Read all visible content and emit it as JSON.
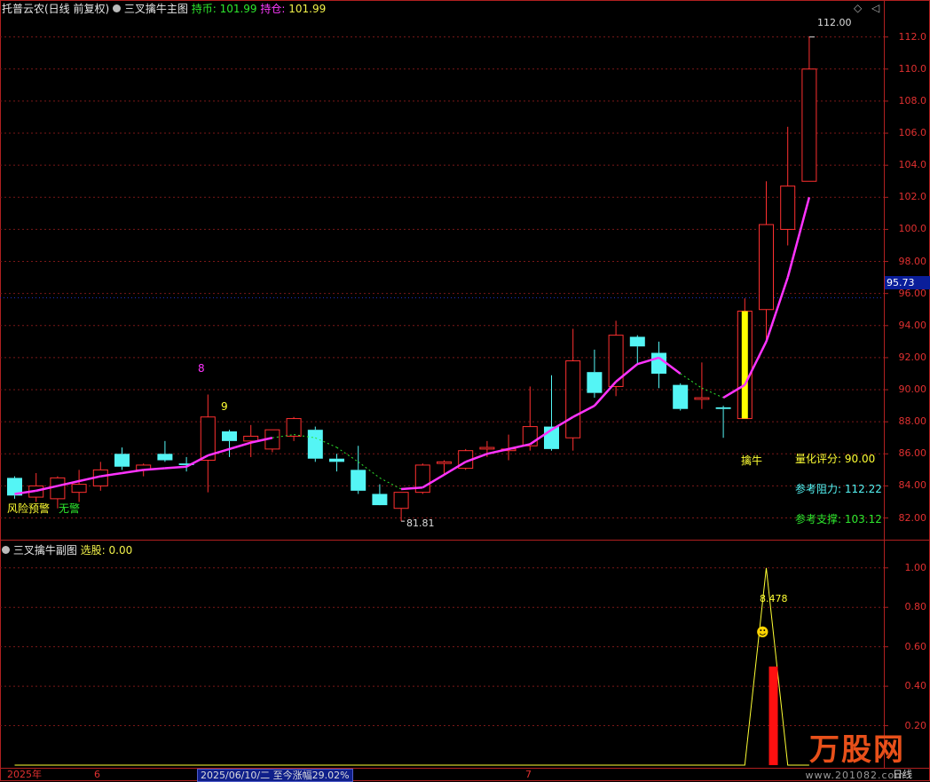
{
  "header": {
    "title": "托普云农(日线 前复权)",
    "indicator": "三叉擒牛主图",
    "close_label": "持币:",
    "close_value": "101.99",
    "hold_label": "持仓:",
    "hold_value": "101.99"
  },
  "subheader": {
    "indicator": "三叉擒牛副图",
    "select_label": "选股:",
    "select_value": "0.00"
  },
  "main_axis": [
    "112.0",
    "110.0",
    "108.0",
    "106.0",
    "104.0",
    "102.0",
    "100.0",
    "98.00",
    "96.00",
    "94.00",
    "92.00",
    "90.00",
    "88.00",
    "86.00",
    "84.00",
    "82.00"
  ],
  "current_price": "95.73",
  "sub_axis": [
    "1.00",
    "0.80",
    "0.60",
    "0.40",
    "0.20"
  ],
  "annotations": {
    "high_label": "112.00",
    "low_label": "81.81",
    "count8": "8",
    "count9": "9",
    "signal": "擒牛",
    "warn_left": "风险预警",
    "warn_right": "无警",
    "sub_value": "8.478"
  },
  "info": {
    "score_label": "量化评分:",
    "score_value": "90.00",
    "resist_label": "参考阻力:",
    "resist_value": "112.22",
    "support_label": "参考支撑:",
    "support_value": "103.12"
  },
  "bottom": {
    "year": "2025年",
    "month6": "6",
    "range_text": "2025/06/10/二  至今涨幅29.02%",
    "month7": "7",
    "period": "日线"
  },
  "watermark": {
    "brand": "万股网",
    "url": "www.201082.com"
  },
  "colors": {
    "up": "#ff3030",
    "down": "#54f5f5",
    "ma": "#ff33ff",
    "signal_bar": "#ffff00",
    "sub_line": "#ffff33",
    "grid": "#7a1818"
  },
  "chart_data": {
    "type": "candlestick",
    "ohlc": [
      {
        "o": 84.5,
        "h": 84.6,
        "l": 83.2,
        "c": 83.4
      },
      {
        "o": 83.3,
        "h": 84.8,
        "l": 83.0,
        "c": 84.0
      },
      {
        "o": 83.2,
        "h": 84.6,
        "l": 82.6,
        "c": 84.5
      },
      {
        "o": 83.6,
        "h": 85.0,
        "l": 83.0,
        "c": 84.1
      },
      {
        "o": 84.0,
        "h": 85.5,
        "l": 83.7,
        "c": 85.0
      },
      {
        "o": 86.0,
        "h": 86.4,
        "l": 85.0,
        "c": 85.2
      },
      {
        "o": 85.0,
        "h": 85.4,
        "l": 84.6,
        "c": 85.3
      },
      {
        "o": 86.0,
        "h": 86.8,
        "l": 85.5,
        "c": 85.6
      },
      {
        "o": 85.4,
        "h": 85.8,
        "l": 84.9,
        "c": 85.3
      },
      {
        "o": 85.6,
        "h": 89.7,
        "l": 83.6,
        "c": 88.3
      },
      {
        "o": 87.4,
        "h": 87.5,
        "l": 85.8,
        "c": 86.8
      },
      {
        "o": 86.8,
        "h": 87.8,
        "l": 85.8,
        "c": 87.1
      },
      {
        "o": 86.3,
        "h": 87.4,
        "l": 86.1,
        "c": 87.5
      },
      {
        "o": 87.1,
        "h": 88.3,
        "l": 86.8,
        "c": 88.2
      },
      {
        "o": 87.5,
        "h": 87.7,
        "l": 85.5,
        "c": 85.7
      },
      {
        "o": 85.7,
        "h": 86.0,
        "l": 84.9,
        "c": 85.5
      },
      {
        "o": 85.0,
        "h": 86.5,
        "l": 83.5,
        "c": 83.7
      },
      {
        "o": 83.5,
        "h": 84.1,
        "l": 82.9,
        "c": 82.8
      },
      {
        "o": 82.6,
        "h": 83.6,
        "l": 81.8,
        "c": 83.6
      },
      {
        "o": 83.6,
        "h": 85.4,
        "l": 83.5,
        "c": 85.3
      },
      {
        "o": 85.4,
        "h": 85.6,
        "l": 84.7,
        "c": 85.5
      },
      {
        "o": 85.1,
        "h": 86.3,
        "l": 85.0,
        "c": 86.2
      },
      {
        "o": 86.3,
        "h": 86.8,
        "l": 85.8,
        "c": 86.4
      },
      {
        "o": 86.2,
        "h": 87.2,
        "l": 85.6,
        "c": 86.3
      },
      {
        "o": 86.5,
        "h": 90.2,
        "l": 86.2,
        "c": 87.7
      },
      {
        "o": 87.7,
        "h": 90.9,
        "l": 86.2,
        "c": 86.3
      },
      {
        "o": 87.0,
        "h": 93.8,
        "l": 86.2,
        "c": 91.8
      },
      {
        "o": 91.1,
        "h": 92.5,
        "l": 89.5,
        "c": 89.8
      },
      {
        "o": 90.2,
        "h": 94.3,
        "l": 89.6,
        "c": 93.4
      },
      {
        "o": 93.3,
        "h": 93.4,
        "l": 91.6,
        "c": 92.7
      },
      {
        "o": 92.3,
        "h": 93.0,
        "l": 90.1,
        "c": 91.0
      },
      {
        "o": 90.3,
        "h": 90.4,
        "l": 88.7,
        "c": 88.8
      },
      {
        "o": 89.4,
        "h": 91.7,
        "l": 88.8,
        "c": 89.5
      },
      {
        "o": 88.9,
        "h": 89.0,
        "l": 87.0,
        "c": 88.8
      },
      {
        "o": 88.2,
        "h": 95.7,
        "l": 88.2,
        "c": 94.9
      },
      {
        "o": 95.0,
        "h": 103.0,
        "l": 93.0,
        "c": 100.3
      },
      {
        "o": 100.0,
        "h": 106.4,
        "l": 99.0,
        "c": 102.7
      },
      {
        "o": 103.0,
        "h": 112.0,
        "l": 103.0,
        "c": 110.0
      }
    ],
    "ma": [
      83.5,
      83.7,
      84.0,
      84.3,
      84.6,
      84.8,
      85.0,
      85.1,
      85.2,
      85.9,
      86.3,
      86.7,
      87.0,
      87.2,
      87.0,
      86.4,
      85.5,
      84.5,
      83.8,
      83.9,
      84.7,
      85.5,
      86.0,
      86.3,
      86.6,
      87.5,
      88.3,
      89.0,
      90.5,
      91.6,
      92.0,
      91.0,
      90.1,
      89.5,
      90.3,
      93.0,
      97.0,
      102.0
    ],
    "ma_dashed": [
      false,
      false,
      false,
      false,
      false,
      false,
      false,
      false,
      false,
      false,
      false,
      false,
      true,
      true,
      true,
      true,
      true,
      true,
      true,
      false,
      false,
      false,
      false,
      false,
      false,
      false,
      false,
      false,
      false,
      false,
      false,
      true,
      true,
      true,
      false,
      false,
      false,
      false
    ],
    "sub_series": [
      0,
      0,
      0,
      0,
      0,
      0,
      0,
      0,
      0,
      0,
      0,
      0,
      0,
      0,
      0,
      0,
      0,
      0,
      0,
      0,
      0,
      0,
      0,
      0,
      0,
      0,
      0,
      0,
      0,
      0,
      0,
      0,
      0,
      0,
      0,
      1.0,
      0,
      0
    ],
    "sub_bar": {
      "index": 35.6,
      "value": 0.5
    },
    "main_ylim": [
      81.2,
      113.2
    ],
    "sub_ylim": [
      0,
      1.08
    ]
  }
}
